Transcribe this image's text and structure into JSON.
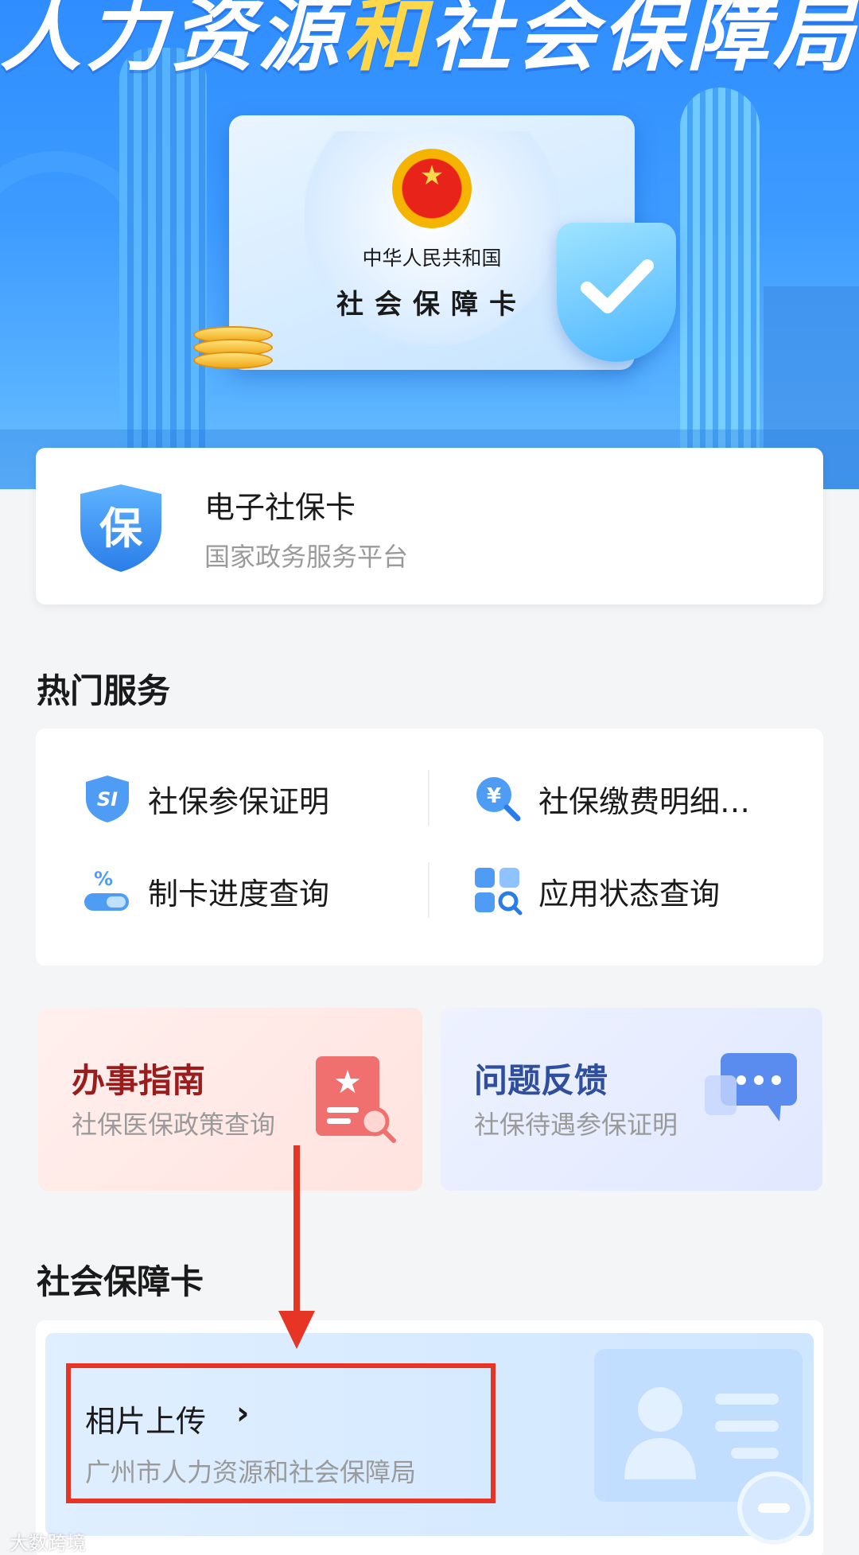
{
  "banner": {
    "title_part1": "人力资源",
    "title_highlight": "和",
    "title_part2": "社会保障局",
    "card_line1": "中华人民共和国",
    "card_line2": "社会保障卡"
  },
  "ecard": {
    "icon_char": "保",
    "title": "电子社保卡",
    "subtitle": "国家政务服务平台"
  },
  "hot_services": {
    "title": "热门服务",
    "items": [
      {
        "label": "社保参保证明",
        "icon": "si-shield-icon"
      },
      {
        "label": "社保缴费明细…",
        "icon": "yuan-search-icon"
      },
      {
        "label": "制卡进度查询",
        "icon": "percent-card-icon"
      },
      {
        "label": "应用状态查询",
        "icon": "grid-search-icon"
      }
    ]
  },
  "tiles": {
    "guide": {
      "title": "办事指南",
      "subtitle": "社保医保政策查询"
    },
    "feedback": {
      "title": "问题反馈",
      "subtitle": "社保待遇参保证明"
    }
  },
  "ss_card": {
    "title": "社会保障卡",
    "photo_upload": {
      "title": "相片上传",
      "subtitle": "广州市人力资源和社会保障局"
    }
  },
  "watermark": "大数跨境",
  "colors": {
    "banner_blue": "#3d9bff",
    "annotation_red": "#e63524",
    "guide_title": "#9b1c1c",
    "feedback_title": "#2f4f9e"
  }
}
